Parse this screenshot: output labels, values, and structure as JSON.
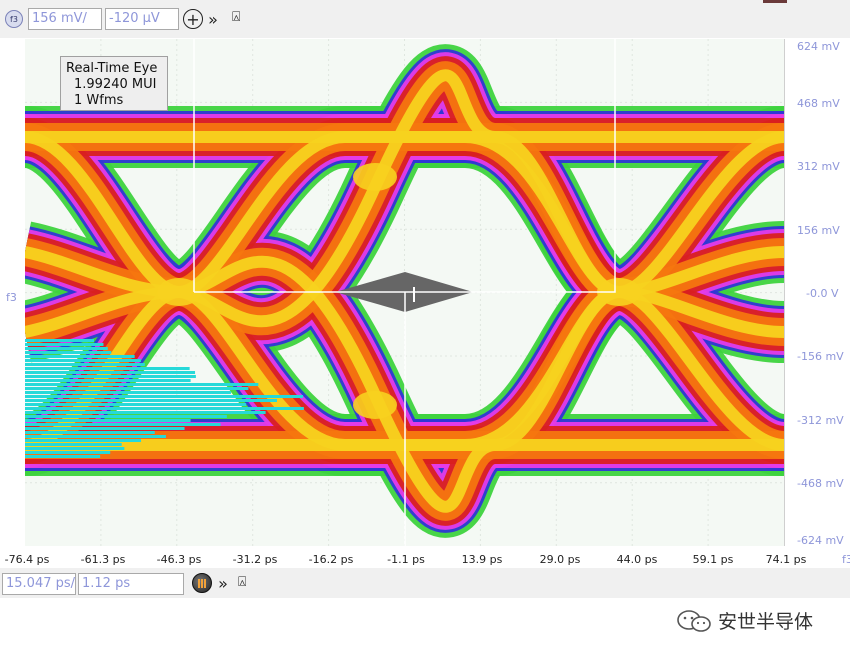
{
  "toolbar": {
    "function_badge": "f3",
    "scale_value": "156 mV/",
    "offset_value": "-120 µV",
    "add_icon": "plus-circle-icon",
    "expand_icon": "double-chevron-right-icon",
    "pin_icon": "pin-icon"
  },
  "legend": {
    "title": "Real-Time Eye",
    "line1": "1.99240 MUI",
    "line2": "1 Wfms"
  },
  "y_axis": {
    "labels": [
      "624 mV",
      "468 mV",
      "312 mV",
      "156 mV",
      "-0.0 V",
      "-156 mV",
      "-312 mV",
      "-468 mV",
      "-624 mV"
    ]
  },
  "x_axis": {
    "labels": [
      "-76.4 ps",
      "-61.3 ps",
      "-46.3 ps",
      "-31.2 ps",
      "-16.2 ps",
      "-1.1 ps",
      "13.9 ps",
      "29.0 ps",
      "44.0 ps",
      "59.1 ps",
      "74.1 ps"
    ]
  },
  "bottom_bar": {
    "timebase_value": "15.047 ps/",
    "delay_value": "1.12 ps",
    "run_icon": "run-stop-icon",
    "expand_icon": "double-chevron-right-icon",
    "pin_icon": "pin-icon"
  },
  "side_marks": {
    "left_marker": "f3",
    "right_marker": "f3"
  },
  "watermark": {
    "text": "安世半导体",
    "icon": "wechat-icon"
  },
  "colors": {
    "trace_hot": "#f7d21f",
    "trace_mid": "#f5760f",
    "trace_red": "#d92020",
    "trace_magenta": "#e53be8",
    "trace_blue": "#2f37d6",
    "trace_green": "#3ed33e",
    "jitter_cyan": "#26d9d9",
    "mask_gray": "#666666",
    "axis_label": "#8e96d9"
  }
}
